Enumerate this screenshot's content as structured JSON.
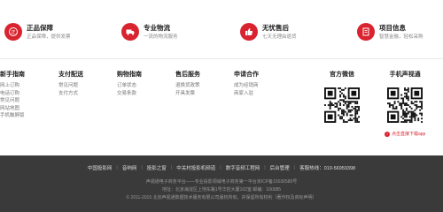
{
  "features": [
    {
      "title": "正品保障",
      "desc": "正品保障，提供发票",
      "icon": "authentic-icon"
    },
    {
      "title": "专业物流",
      "desc": "一流的物流服务",
      "icon": "truck-icon"
    },
    {
      "title": "无忧售后",
      "desc": "七天无理由退货",
      "icon": "thumbs-up-icon"
    },
    {
      "title": "项目信息",
      "desc": "智慧金融，轻松采购",
      "icon": "info-icon"
    }
  ],
  "columns": [
    {
      "title": "新手指南",
      "links": [
        "网上订购",
        "电话订购",
        "常见问题",
        "网站地图",
        "手机触屏版"
      ]
    },
    {
      "title": "支付配送",
      "links": [
        "常见问题",
        "支付方式"
      ]
    },
    {
      "title": "购物指南",
      "links": [
        "订单状态",
        "交易条款"
      ]
    },
    {
      "title": "售后服务",
      "links": [
        "退换货政策",
        "开具发票"
      ]
    },
    {
      "title": "申请合作",
      "links": [
        "成为经销商",
        "商家入驻"
      ]
    }
  ],
  "qr": {
    "wechat_title": "官方微信",
    "mobile_title": "手机声视通",
    "note": "点击直接下载app"
  },
  "footer": {
    "links": [
      "中国投影网",
      "音响网",
      "投影之窗",
      "中关村投影机频道",
      "数字音频工程网",
      "后台管理",
      "客服热线：010-56959398"
    ],
    "line1": "声视通电子商务平台——专业投影领域电子商务第一平台京ICP备15030580号",
    "line2": "地址：北京海淀区上地东路1号华控大厦102室 邮编：100085",
    "line3": "© 2011-2015 北京声视通数据技术服务有限公司版权所有，并保留所有权利（著作权及商标声明）"
  },
  "colors": {
    "accent": "#d9232f",
    "footer_bg": "#3a3a3a"
  }
}
